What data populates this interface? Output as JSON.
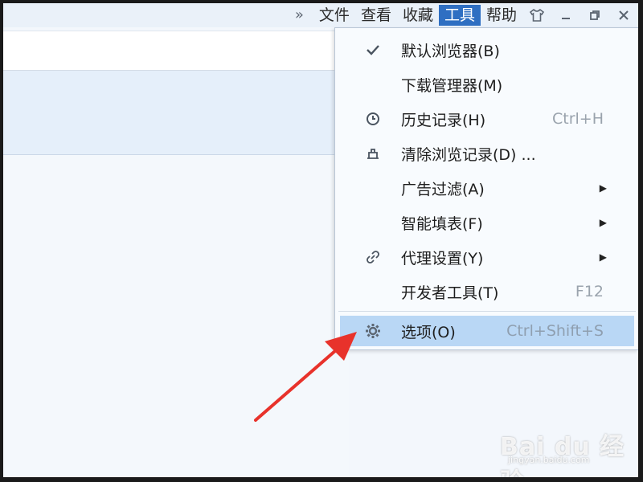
{
  "menubar": {
    "overflow_icon": "double-chevron-right",
    "items": [
      {
        "label": "文件"
      },
      {
        "label": "查看"
      },
      {
        "label": "收藏"
      },
      {
        "label": "工具",
        "active": true
      },
      {
        "label": "帮助"
      }
    ],
    "window_buttons": [
      "skin-shirt-icon",
      "minimize-icon",
      "restore-icon",
      "close-icon"
    ]
  },
  "tools_menu": {
    "items": [
      {
        "label": "默认浏览器(B)",
        "icon": "check-icon",
        "shortcut": ""
      },
      {
        "label": "下载管理器(M)",
        "icon": "",
        "shortcut": ""
      },
      {
        "label": "历史记录(H)",
        "icon": "clock-icon",
        "shortcut": "Ctrl+H"
      },
      {
        "label": "清除浏览记录(D) ...",
        "icon": "eraser-icon",
        "shortcut": ""
      },
      {
        "label": "广告过滤(A)",
        "icon": "",
        "submenu": true
      },
      {
        "label": "智能填表(F)",
        "icon": "",
        "submenu": true
      },
      {
        "label": "代理设置(Y)",
        "icon": "link-icon",
        "submenu": true
      },
      {
        "label": "开发者工具(T)",
        "icon": "",
        "shortcut": "F12"
      },
      {
        "label": "选项(O)",
        "icon": "gear-icon",
        "shortcut": "Ctrl+Shift+S",
        "highlighted": true
      }
    ]
  },
  "watermark": {
    "brand": "Bai du 经验",
    "url": "jingyan.baidu.com"
  },
  "colors": {
    "menu_active_bg": "#2f6fc2",
    "highlight_bg": "#b9d7f5",
    "arrow_red": "#e8322b"
  }
}
